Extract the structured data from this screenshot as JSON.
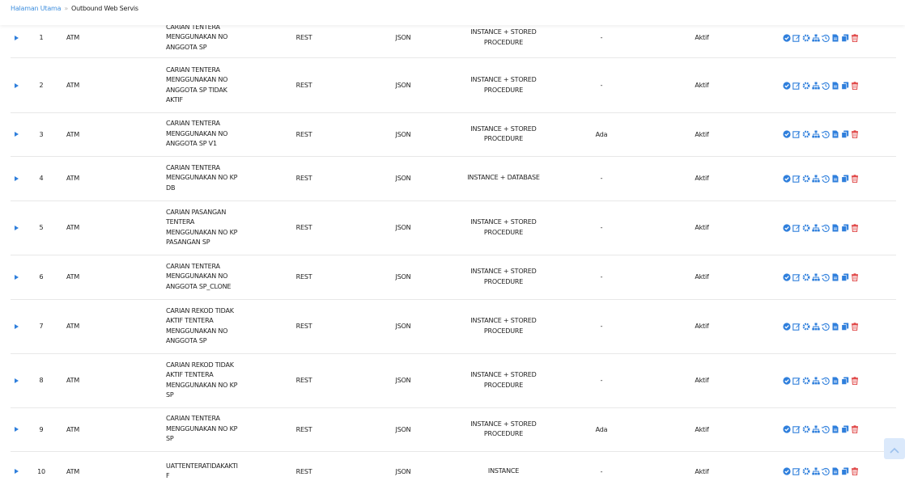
{
  "breadcrumb": {
    "home": "Halaman Utama",
    "separator": "»",
    "current": "Outbound Web Servis"
  },
  "colors": {
    "accent": "#2f7fdc",
    "delete": "#e04848",
    "link": "#3f8fde"
  },
  "row_actions": [
    "check-circle-icon",
    "edit-icon",
    "gear-icon",
    "sitemap-icon",
    "history-icon",
    "document-icon",
    "copy-icon",
    "trash-icon"
  ],
  "rows": [
    {
      "no": "1",
      "system": "ATM",
      "description": [
        "CARIAN TENTERA",
        "MENGGUNAKAN NO",
        "ANGGOTA SP"
      ],
      "protocol": "REST",
      "format": "JSON",
      "type": [
        "INSTANCE + STORED",
        "PROCEDURE"
      ],
      "date": "-",
      "status": "Aktif"
    },
    {
      "no": "2",
      "system": "ATM",
      "description": [
        "CARIAN TENTERA",
        "MENGGUNAKAN NO",
        "ANGGOTA SP TIDAK",
        "AKTIF"
      ],
      "protocol": "REST",
      "format": "JSON",
      "type": [
        "INSTANCE + STORED",
        "PROCEDURE"
      ],
      "date": "-",
      "status": "Aktif"
    },
    {
      "no": "3",
      "system": "ATM",
      "description": [
        "CARIAN TENTERA",
        "MENGGUNAKAN NO",
        "ANGGOTA SP V1"
      ],
      "protocol": "REST",
      "format": "JSON",
      "type": [
        "INSTANCE + STORED",
        "PROCEDURE"
      ],
      "date": "Ada",
      "status": "Aktif"
    },
    {
      "no": "4",
      "system": "ATM",
      "description": [
        "CARIAN TENTERA",
        "MENGGUNAKAN NO KP",
        "DB"
      ],
      "protocol": "REST",
      "format": "JSON",
      "type": [
        "INSTANCE + DATABASE"
      ],
      "date": "-",
      "status": "Aktif"
    },
    {
      "no": "5",
      "system": "ATM",
      "description": [
        "CARIAN PASANGAN",
        "TENTERA",
        "MENGGUNAKAN NO KP",
        "PASANGAN SP"
      ],
      "protocol": "REST",
      "format": "JSON",
      "type": [
        "INSTANCE + STORED",
        "PROCEDURE"
      ],
      "date": "-",
      "status": "Aktif"
    },
    {
      "no": "6",
      "system": "ATM",
      "description": [
        "CARIAN TENTERA",
        "MENGGUNAKAN NO",
        "ANGGOTA SP_CLONE"
      ],
      "protocol": "REST",
      "format": "JSON",
      "type": [
        "INSTANCE + STORED",
        "PROCEDURE"
      ],
      "date": "-",
      "status": "Aktif"
    },
    {
      "no": "7",
      "system": "ATM",
      "description": [
        "CARIAN REKOD TIDAK",
        "AKTIF TENTERA",
        "MENGGUNAKAN NO",
        "ANGGOTA SP"
      ],
      "protocol": "REST",
      "format": "JSON",
      "type": [
        "INSTANCE + STORED",
        "PROCEDURE"
      ],
      "date": "-",
      "status": "Aktif"
    },
    {
      "no": "8",
      "system": "ATM",
      "description": [
        "CARIAN REKOD TIDAK",
        "AKTIF TENTERA",
        "MENGGUNAKAN NO KP",
        "SP"
      ],
      "protocol": "REST",
      "format": "JSON",
      "type": [
        "INSTANCE + STORED",
        "PROCEDURE"
      ],
      "date": "-",
      "status": "Aktif"
    },
    {
      "no": "9",
      "system": "ATM",
      "description": [
        "CARIAN TENTERA",
        "MENGGUNAKAN NO KP",
        "SP"
      ],
      "protocol": "REST",
      "format": "JSON",
      "type": [
        "INSTANCE + STORED",
        "PROCEDURE"
      ],
      "date": "Ada",
      "status": "Aktif"
    },
    {
      "no": "10",
      "system": "ATM",
      "description": [
        "UATTENTERATIDAKAKTI",
        "F"
      ],
      "protocol": "REST",
      "format": "JSON",
      "type": [
        "INSTANCE"
      ],
      "date": "-",
      "status": "Aktif"
    }
  ]
}
